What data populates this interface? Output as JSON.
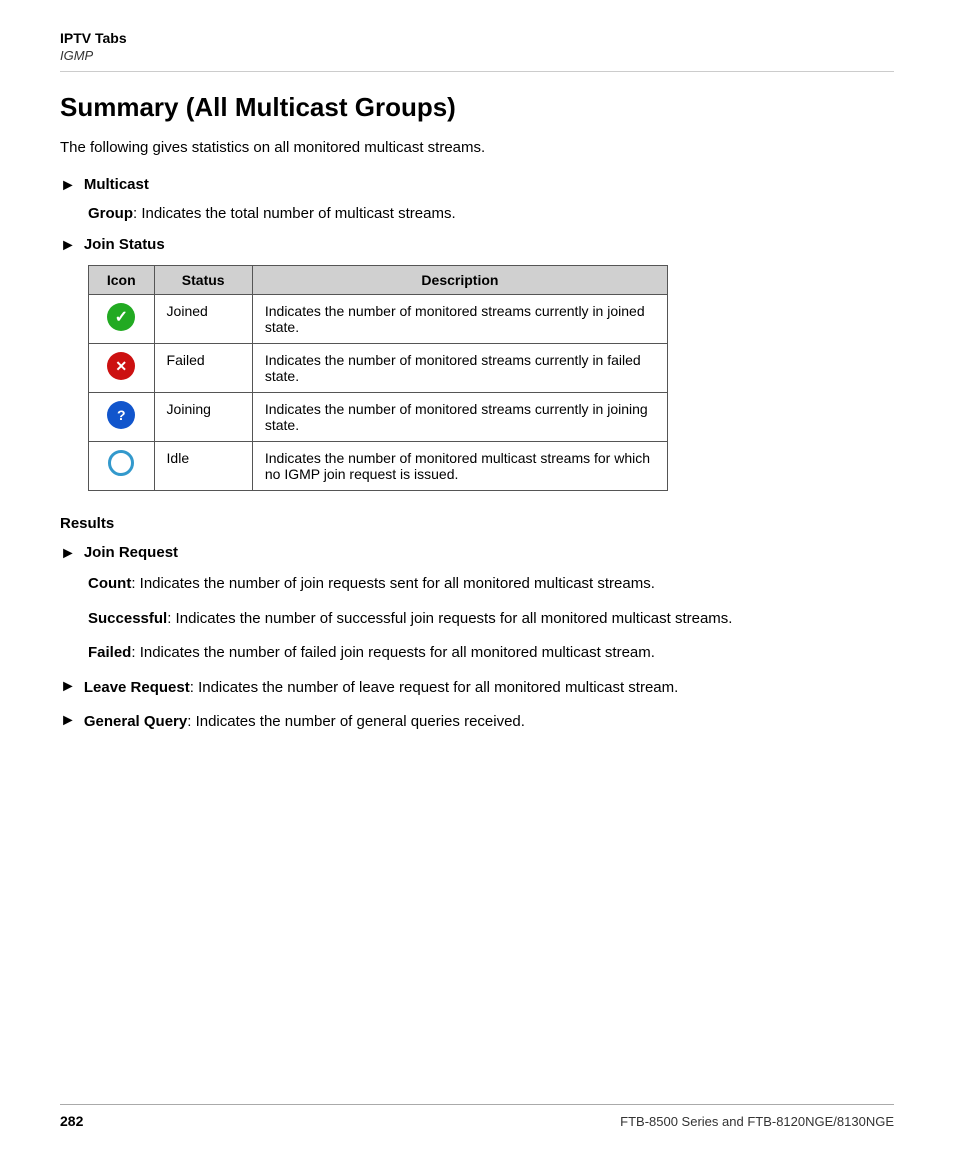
{
  "header": {
    "title": "IPTV Tabs",
    "subtitle": "IGMP"
  },
  "page_title": "Summary (All Multicast Groups)",
  "intro": "The following gives statistics on all monitored multicast streams.",
  "sections": {
    "multicast": {
      "label": "Multicast",
      "group_desc_bold": "Group",
      "group_desc_rest": ": Indicates the total number of multicast streams."
    },
    "join_status": {
      "label": "Join Status",
      "table": {
        "headers": [
          "Icon",
          "Status",
          "Description"
        ],
        "rows": [
          {
            "icon_type": "green-check",
            "status": "Joined",
            "description": "Indicates the number of monitored streams currently in joined state."
          },
          {
            "icon_type": "red-x",
            "status": "Failed",
            "description": "Indicates the number of monitored streams currently in failed state."
          },
          {
            "icon_type": "blue-q",
            "status": "Joining",
            "description": "Indicates the number of monitored streams currently in joining state."
          },
          {
            "icon_type": "idle-ring",
            "status": "Idle",
            "description": "Indicates the number of monitored multicast streams for which no IGMP join request is issued."
          }
        ]
      }
    }
  },
  "results": {
    "label": "Results",
    "join_request": {
      "label": "Join Request",
      "items": [
        {
          "bold": "Count",
          "rest": ": Indicates the number of join requests sent for all monitored multicast streams."
        },
        {
          "bold": "Successful",
          "rest": ": Indicates the number of successful join requests for all monitored multicast streams."
        },
        {
          "bold": "Failed",
          "rest": ": Indicates the number of failed join requests for all monitored multicast stream."
        }
      ]
    },
    "leave_request": {
      "bold": "Leave Request",
      "rest": ": Indicates the number of leave request for all monitored multicast stream."
    },
    "general_query": {
      "bold": "General Query",
      "rest": ": Indicates the number of general queries received."
    }
  },
  "footer": {
    "page_number": "282",
    "product": "FTB-8500 Series and FTB-8120NGE/8130NGE"
  }
}
